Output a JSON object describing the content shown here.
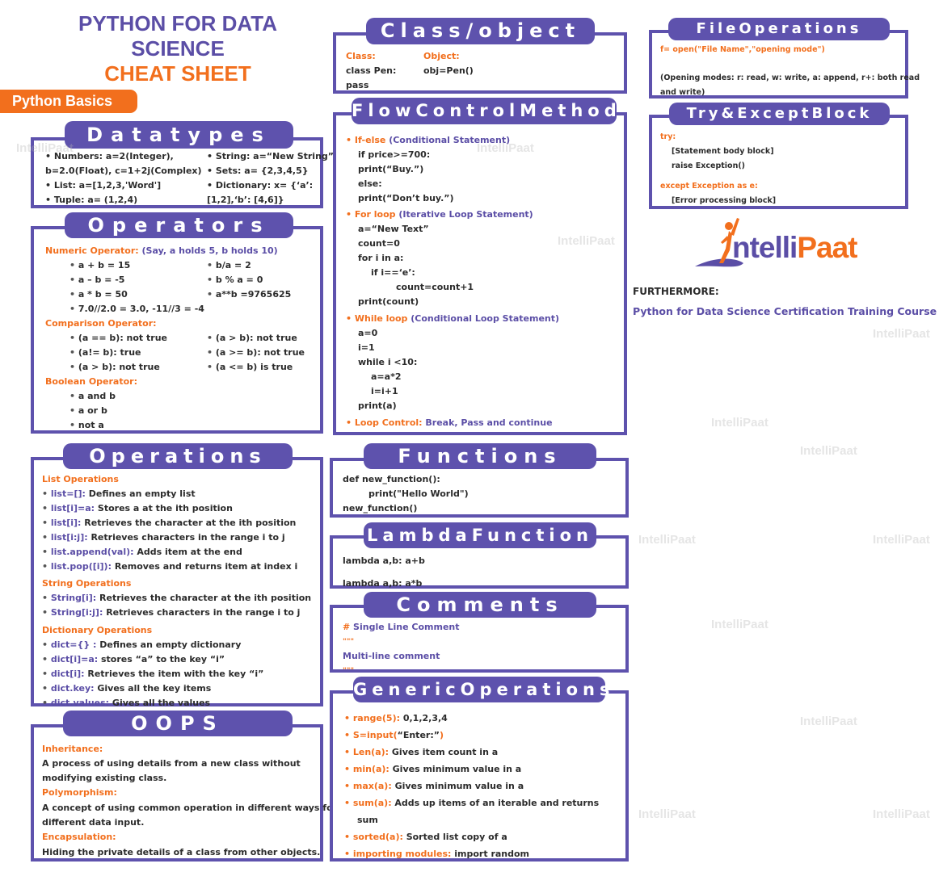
{
  "title": {
    "line1": "PYTHON FOR DATA",
    "line2": "SCIENCE",
    "line3": "CHEAT SHEET"
  },
  "section_tag": "Python Basics",
  "colors": {
    "purple": "#5e52ad",
    "orange": "#f26f1d",
    "text": "#2b2b2b"
  },
  "datatypes": {
    "header": "Datatypes",
    "left": [
      "• Numbers: a=2(Integer),",
      "b=2.0(Float), c=1+2j(Complex)",
      "• List: a=[1,2,3,'Word']",
      "• Tuple: a= (1,2,4)"
    ],
    "right": [
      "• String: a=“New String”",
      "• Sets: a= {2,3,4,5}",
      "• Dictionary: x= {‘a’:",
      "[1,2],‘b’: [4,6]}"
    ]
  },
  "operators": {
    "header": "Operators",
    "numeric_label": "Numeric Operator:",
    "numeric_note": "(Say, a holds 5, b holds 10)",
    "numeric_left": [
      "a + b = 15",
      "a – b = -5",
      "a * b = 50",
      "7.0//2.0 = 3.0, -11//3 = -4"
    ],
    "numeric_right": [
      "b/a = 2",
      "b % a = 0",
      "a**b =9765625"
    ],
    "comparison_label": "Comparison Operator:",
    "comparison_left": [
      "(a == b): not true",
      "(a!= b): true",
      "(a > b): not true"
    ],
    "comparison_right": [
      "(a > b): not true",
      "(a >= b): not true",
      "(a <= b) is true"
    ],
    "boolean_label": "Boolean Operator:",
    "boolean": [
      "a and b",
      "a or b",
      "not a"
    ]
  },
  "operations": {
    "header": "Operations",
    "list_label": "List Operations",
    "list": [
      {
        "code": "list=[]:",
        "desc": " Defines an empty list"
      },
      {
        "code": "list[i]=a:",
        "desc": " Stores a at the ith position"
      },
      {
        "code": "list[i]:",
        "desc": " Retrieves the character at the ith position"
      },
      {
        "code": "list[i:j]:",
        "desc": " Retrieves characters in the range i to j"
      },
      {
        "code": "list.append(val):",
        "desc": " Adds item at the end"
      },
      {
        "code": "list.pop([i]):",
        "desc": " Removes and returns item at index i"
      }
    ],
    "string_label": "String Operations",
    "string": [
      {
        "code": "String[i]:",
        "desc": " Retrieves the character at the ith position"
      },
      {
        "code": "String[i:j]:",
        "desc": " Retrieves characters in the range i to j"
      }
    ],
    "dict_label": "Dictionary Operations",
    "dict": [
      {
        "code": "dict={} :",
        "desc": " Defines an empty dictionary"
      },
      {
        "code": "dict[i]=a:",
        "desc": " stores “a” to the key “i”"
      },
      {
        "code": "dict[i]:",
        "desc": " Retrieves the item with the key “i”"
      },
      {
        "code": "dict.key:",
        "desc": " Gives all the key items"
      },
      {
        "code": "dict.values:",
        "desc": " Gives all the values"
      }
    ]
  },
  "oops": {
    "header": "OOPS",
    "items": [
      {
        "label": "Inheritance:",
        "text1": "A process of using details from a new class without",
        "text2": "modifying existing class."
      },
      {
        "label": "Polymorphism:",
        "text1": "A concept of using common operation in different ways for",
        "text2": "different data input."
      },
      {
        "label": "Encapsulation:",
        "text1": "Hiding the private details of a class from other objects.",
        "text2": ""
      }
    ]
  },
  "class_object": {
    "header": "Class/object",
    "class_label": "Class:",
    "class_lines": [
      "class Pen:",
      "pass"
    ],
    "object_label": "Object:",
    "object_line": "obj=Pen()"
  },
  "flow_control": {
    "header": "FlowControlMethod",
    "ifelse_label": "If-else",
    "ifelse_note": " (Conditional Statement)",
    "ifelse_code": [
      "if price>=700:",
      "print(“Buy.”)",
      "else:",
      "print(“Don’t buy.”)"
    ],
    "for_label": "For loop",
    "for_note": " (Iterative Loop Statement)",
    "for_code": [
      "a=“New Text”",
      "count=0",
      "for i in a:",
      "if i==‘e’:",
      "count=count+1",
      "print(count)"
    ],
    "while_label": "While loop",
    "while_note": " (Conditional Loop Statement)",
    "while_code": [
      "a=0",
      "i=1",
      "while i <10:",
      "a=a*2",
      "i=i+1",
      "print(a)"
    ],
    "loop_control_label": "Loop Control:",
    "loop_control_value": "  Break, Pass and continue"
  },
  "functions": {
    "header": "Functions",
    "code": [
      "def new_function():",
      "print(\"Hello World\")",
      "new_function()"
    ]
  },
  "lambda": {
    "header": "LambdaFunction",
    "code": [
      "lambda a,b: a+b",
      "lambda a,b: a*b"
    ]
  },
  "comments": {
    "header": "Comments",
    "hash": "#",
    "single": " Single Line Comment",
    "quotes": "\"\"\"",
    "multi": "Multi-line comment"
  },
  "generic": {
    "header": "GenericOperations",
    "items": [
      {
        "code": "range(5):",
        "desc": " 0,1,2,3,4"
      },
      {
        "code": "S=input(",
        "desc": "“Enter:”",
        "tail": ")"
      },
      {
        "code": "Len(a):",
        "desc": " Gives item count in a"
      },
      {
        "code": "min(a):",
        "desc": " Gives minimum value in a"
      },
      {
        "code": "max(a):",
        "desc": " Gives minimum value in a"
      },
      {
        "code": "sum(a):",
        "desc": " Adds up items of an iterable and returns"
      },
      {
        "code": "",
        "desc": "sum"
      },
      {
        "code": "sorted(a):",
        "desc": " Sorted list copy of a"
      },
      {
        "code": "importing modules:",
        "desc": " import random"
      }
    ]
  },
  "file_ops": {
    "header": "FileOperations",
    "open_line": "f= open(\"File Name\",\"opening mode\")",
    "modes_1": "(Opening modes: r: read, w: write, a: append, r+: both read",
    "modes_2": "and write)"
  },
  "try_except": {
    "header": "Try&ExceptBlock",
    "try_label": "try:",
    "try_lines": [
      "[Statement body block]",
      "raise Exception()"
    ],
    "except_label": "except Exception as e:",
    "except_line": "[Error processing block]"
  },
  "logo": {
    "part1": "ntelli",
    "part2": "Paat"
  },
  "furthermore": {
    "label": "FURTHERMORE:",
    "course": "Python for Data Science Certification Training Course"
  },
  "watermark": "IntelliPaat"
}
